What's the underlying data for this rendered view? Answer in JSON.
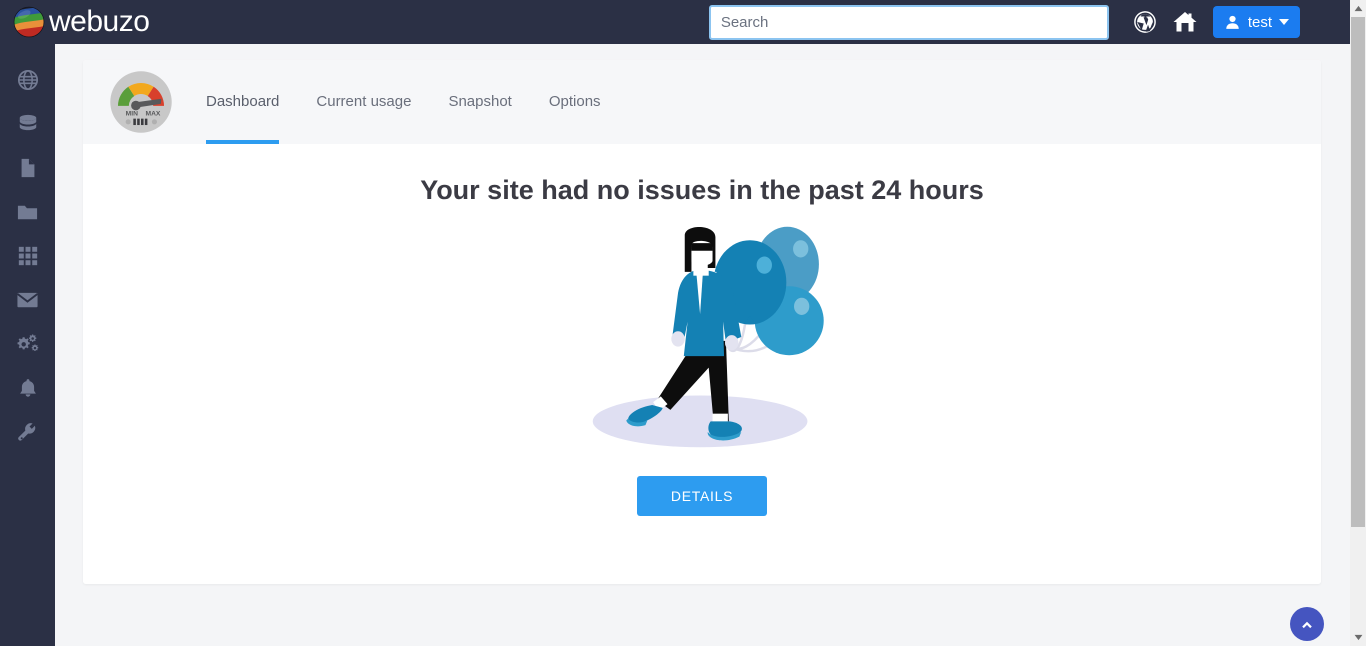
{
  "header": {
    "brand": "webuzo",
    "brand_logo_icon": "webuzo-globe-logo",
    "search": {
      "placeholder": "Search",
      "value": ""
    },
    "wordpress_icon": "wordpress-icon",
    "home_icon": "home-icon",
    "user": {
      "name": "test",
      "avatar_icon": "user-icon",
      "caret_icon": "caret-down-icon"
    },
    "colors": {
      "background": "#2b3045",
      "user_button": "#1b7cf0",
      "search_border": "#8cc4f0"
    }
  },
  "sidebar": {
    "items": [
      {
        "name": "globe-icon",
        "label": "Domains"
      },
      {
        "name": "database-icon",
        "label": "Databases"
      },
      {
        "name": "file-icon",
        "label": "Files"
      },
      {
        "name": "folder-icon",
        "label": "Folders"
      },
      {
        "name": "grid-icon",
        "label": "Apps"
      },
      {
        "name": "envelope-icon",
        "label": "Email"
      },
      {
        "name": "gears-icon",
        "label": "Settings"
      },
      {
        "name": "bell-icon",
        "label": "Notifications"
      },
      {
        "name": "wrench-icon",
        "label": "Tools"
      }
    ]
  },
  "card": {
    "gauge_icon": "speedometer-icon",
    "gauge_labels": {
      "min": "MIN",
      "max": "MAX"
    },
    "tabs": [
      {
        "label": "Dashboard",
        "active": true
      },
      {
        "label": "Current usage",
        "active": false
      },
      {
        "label": "Snapshot",
        "active": false
      },
      {
        "label": "Options",
        "active": false
      }
    ],
    "headline": "Your site had no issues in the past 24 hours",
    "illustration": "person-walking-with-balloons-illustration",
    "details_button": "DETAILS",
    "colors": {
      "accent": "#2d9cf0",
      "headline": "#3b3b44",
      "card_header_bg": "#f6f7f9",
      "page_bg": "#f4f5f7"
    }
  },
  "scroll_top": {
    "icon": "chevron-up-icon",
    "color": "#4555c0"
  },
  "scrollbar": {
    "up_icon": "scroll-up-arrow",
    "down_icon": "scroll-down-arrow"
  }
}
